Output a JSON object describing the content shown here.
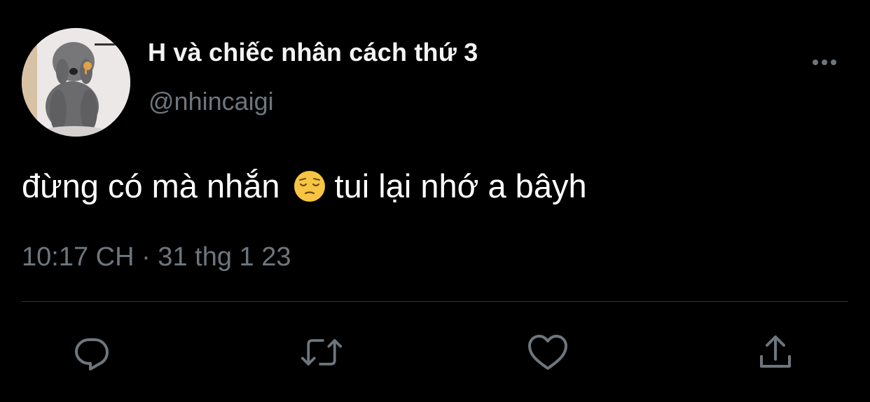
{
  "tweet": {
    "author": {
      "display_name": "H và chiếc nhân cách thứ 3",
      "handle": "@nhincaigi",
      "avatar_icon": "poodle-dog-avatar"
    },
    "text_before_emoji": "đừng có mà nhắn",
    "emoji": "pensive-face",
    "text_after_emoji": "tui lại nhớ a bâyh",
    "timestamp": "10:17 CH · 31 thg 1 23"
  },
  "actions": {
    "reply": "reply-icon",
    "retweet": "retweet-icon",
    "like": "heart-icon",
    "share": "share-icon",
    "more": "more-horizontal-icon"
  },
  "colors": {
    "background": "#000000",
    "primary_text": "#ffffff",
    "secondary_text": "#6e767d",
    "divider": "#2f3336"
  }
}
